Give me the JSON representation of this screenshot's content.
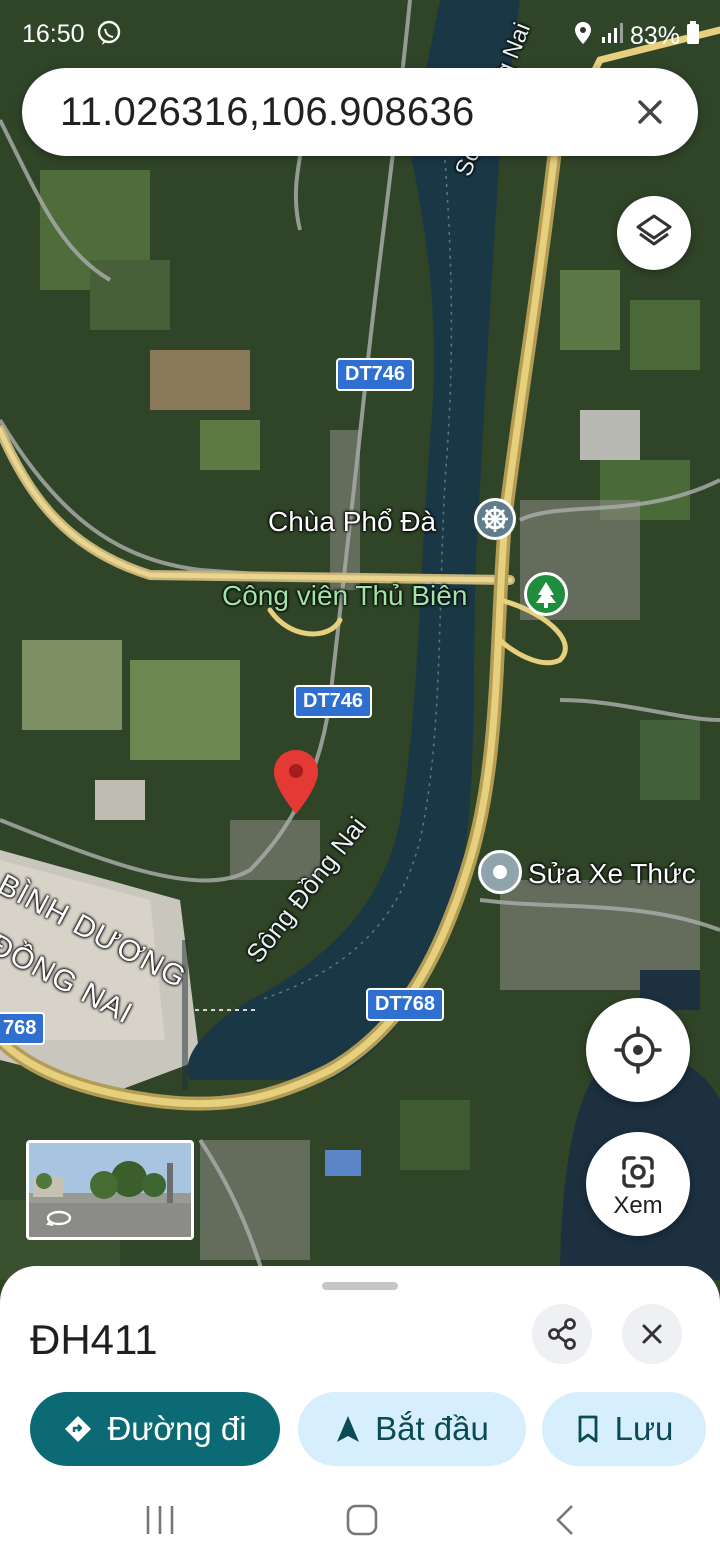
{
  "status": {
    "time": "16:50",
    "battery": "83%"
  },
  "search": {
    "query": "11.026316,106.908636"
  },
  "map": {
    "labels": {
      "chua_pho_da": "Chùa Phổ Đà",
      "cong_vien": "Công viên Thủ Biên",
      "sua_xe": "Sửa Xe Thức",
      "song_dong_nai": "Sông Đồng Nai",
      "song_dong_nai_top": "Sông Đồng Nai",
      "binh_duong": "BÌNH DƯƠNG",
      "dong_nai": "ĐỒNG NAI"
    },
    "shields": {
      "dt746_top": "DT746",
      "dt746_mid": "DT746",
      "dt768_center": "DT768",
      "dt768_left": "768"
    }
  },
  "buttons": {
    "xem_label": "Xem"
  },
  "sheet": {
    "title": "ĐH411",
    "directions_label": "Đường đi",
    "start_label": "Bắt đầu",
    "save_label": "Lưu"
  },
  "colors": {
    "accent": "#0b6a73",
    "pill_light": "#d7eefc",
    "pin": "#e53935",
    "road_shield": "#2f6fd0",
    "park": "#1e8e3e"
  }
}
